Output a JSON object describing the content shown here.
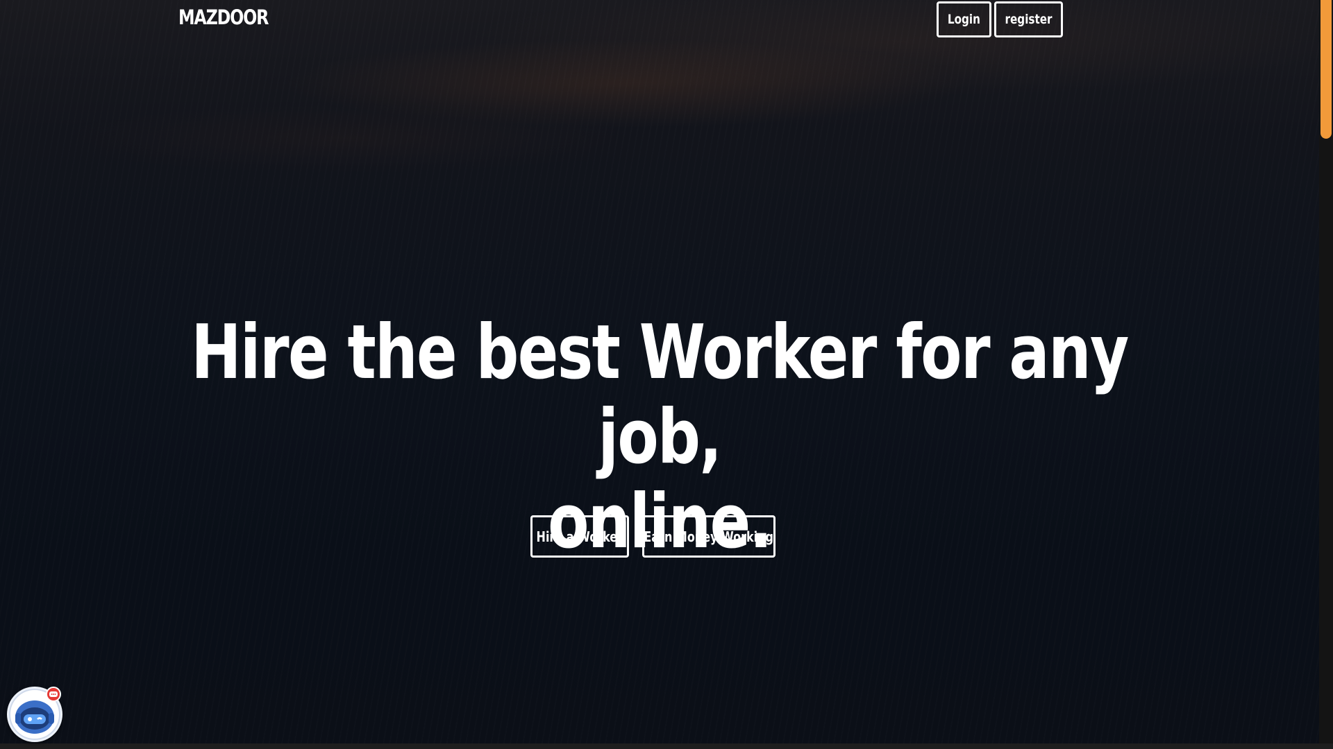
{
  "brand": {
    "name": "MAZDOOR"
  },
  "nav": {
    "login_label": "Login",
    "register_label": "register"
  },
  "hero": {
    "title_line1": "Hire the best Worker for any job,",
    "title_line2": "online.",
    "hire_button_label": "Hire a Worker",
    "earn_button_label": "Earn Money Working"
  },
  "chat_widget": {
    "icon": "robot-chat-icon",
    "badge_icon": "chat-bubble-icon"
  },
  "colors": {
    "background": "#0b0f17",
    "text": "#ffffff",
    "scrollbar_thumb": "#f29a3a",
    "badge": "#e53935"
  }
}
